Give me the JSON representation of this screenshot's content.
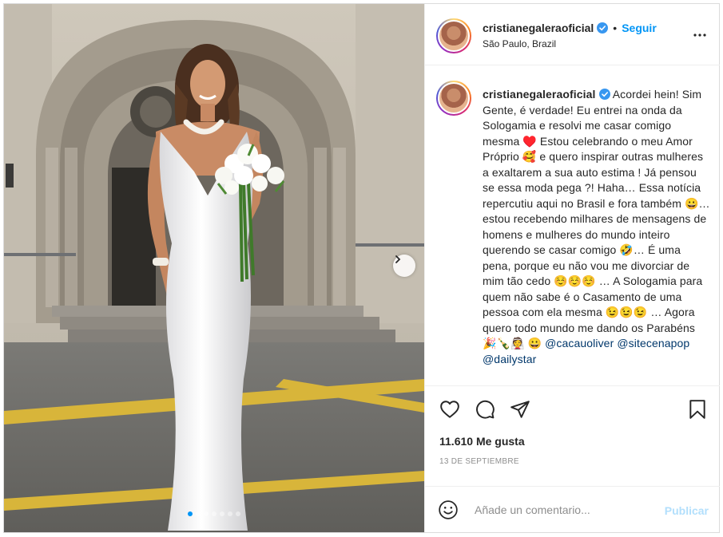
{
  "post": {
    "username": "cristianegaleraoficial",
    "verified": true,
    "follow_label": "Seguir",
    "location": "São Paulo, Brazil",
    "caption": " Acordei hein! Sim Gente, é verdade! Eu entrei na onda da Sologamia e resolvi me casar comigo mesma ♥️ Estou celebrando o meu Amor Próprio 🥰 e quero inspirar outras mulheres a exaltarem a sua auto estima ! Já pensou se essa moda pega ?! Haha… Essa notícia repercutiu aqui no Brasil e fora também 😀… estou recebendo milhares de mensagens de homens e mulheres do mundo inteiro querendo se casar comigo 🤣… É uma pena, porque eu não vou me divorciar de mim tão cedo ☺️☺️☺️ … A Sologamia para quem não sabe é o Casamento de uma pessoa com ela mesma 😉😉😉 … Agora quero todo mundo me dando os Parabéns 🎉🍾👰 😀 ",
    "mentions": [
      "@cacauoliver",
      "@sitecenapop",
      "@dailystar"
    ],
    "likes": "11.610 Me gusta",
    "date": "13 DE SEPTIEMBRE",
    "comment_placeholder": "Añade un comentario...",
    "publish_label": "Publicar",
    "carousel": {
      "slides": 7,
      "active": 0
    }
  },
  "icons": {
    "verified": "verified-badge-icon",
    "more": "more-options-icon",
    "like": "heart-icon",
    "comment": "comment-icon",
    "share": "share-icon",
    "save": "bookmark-icon",
    "emoji": "emoji-icon",
    "next": "chevron-right-icon"
  },
  "colors": {
    "accent": "#0095f6",
    "mention": "#00376b",
    "muted": "#8e8e8e",
    "publish_disabled": "#b2dffc"
  }
}
